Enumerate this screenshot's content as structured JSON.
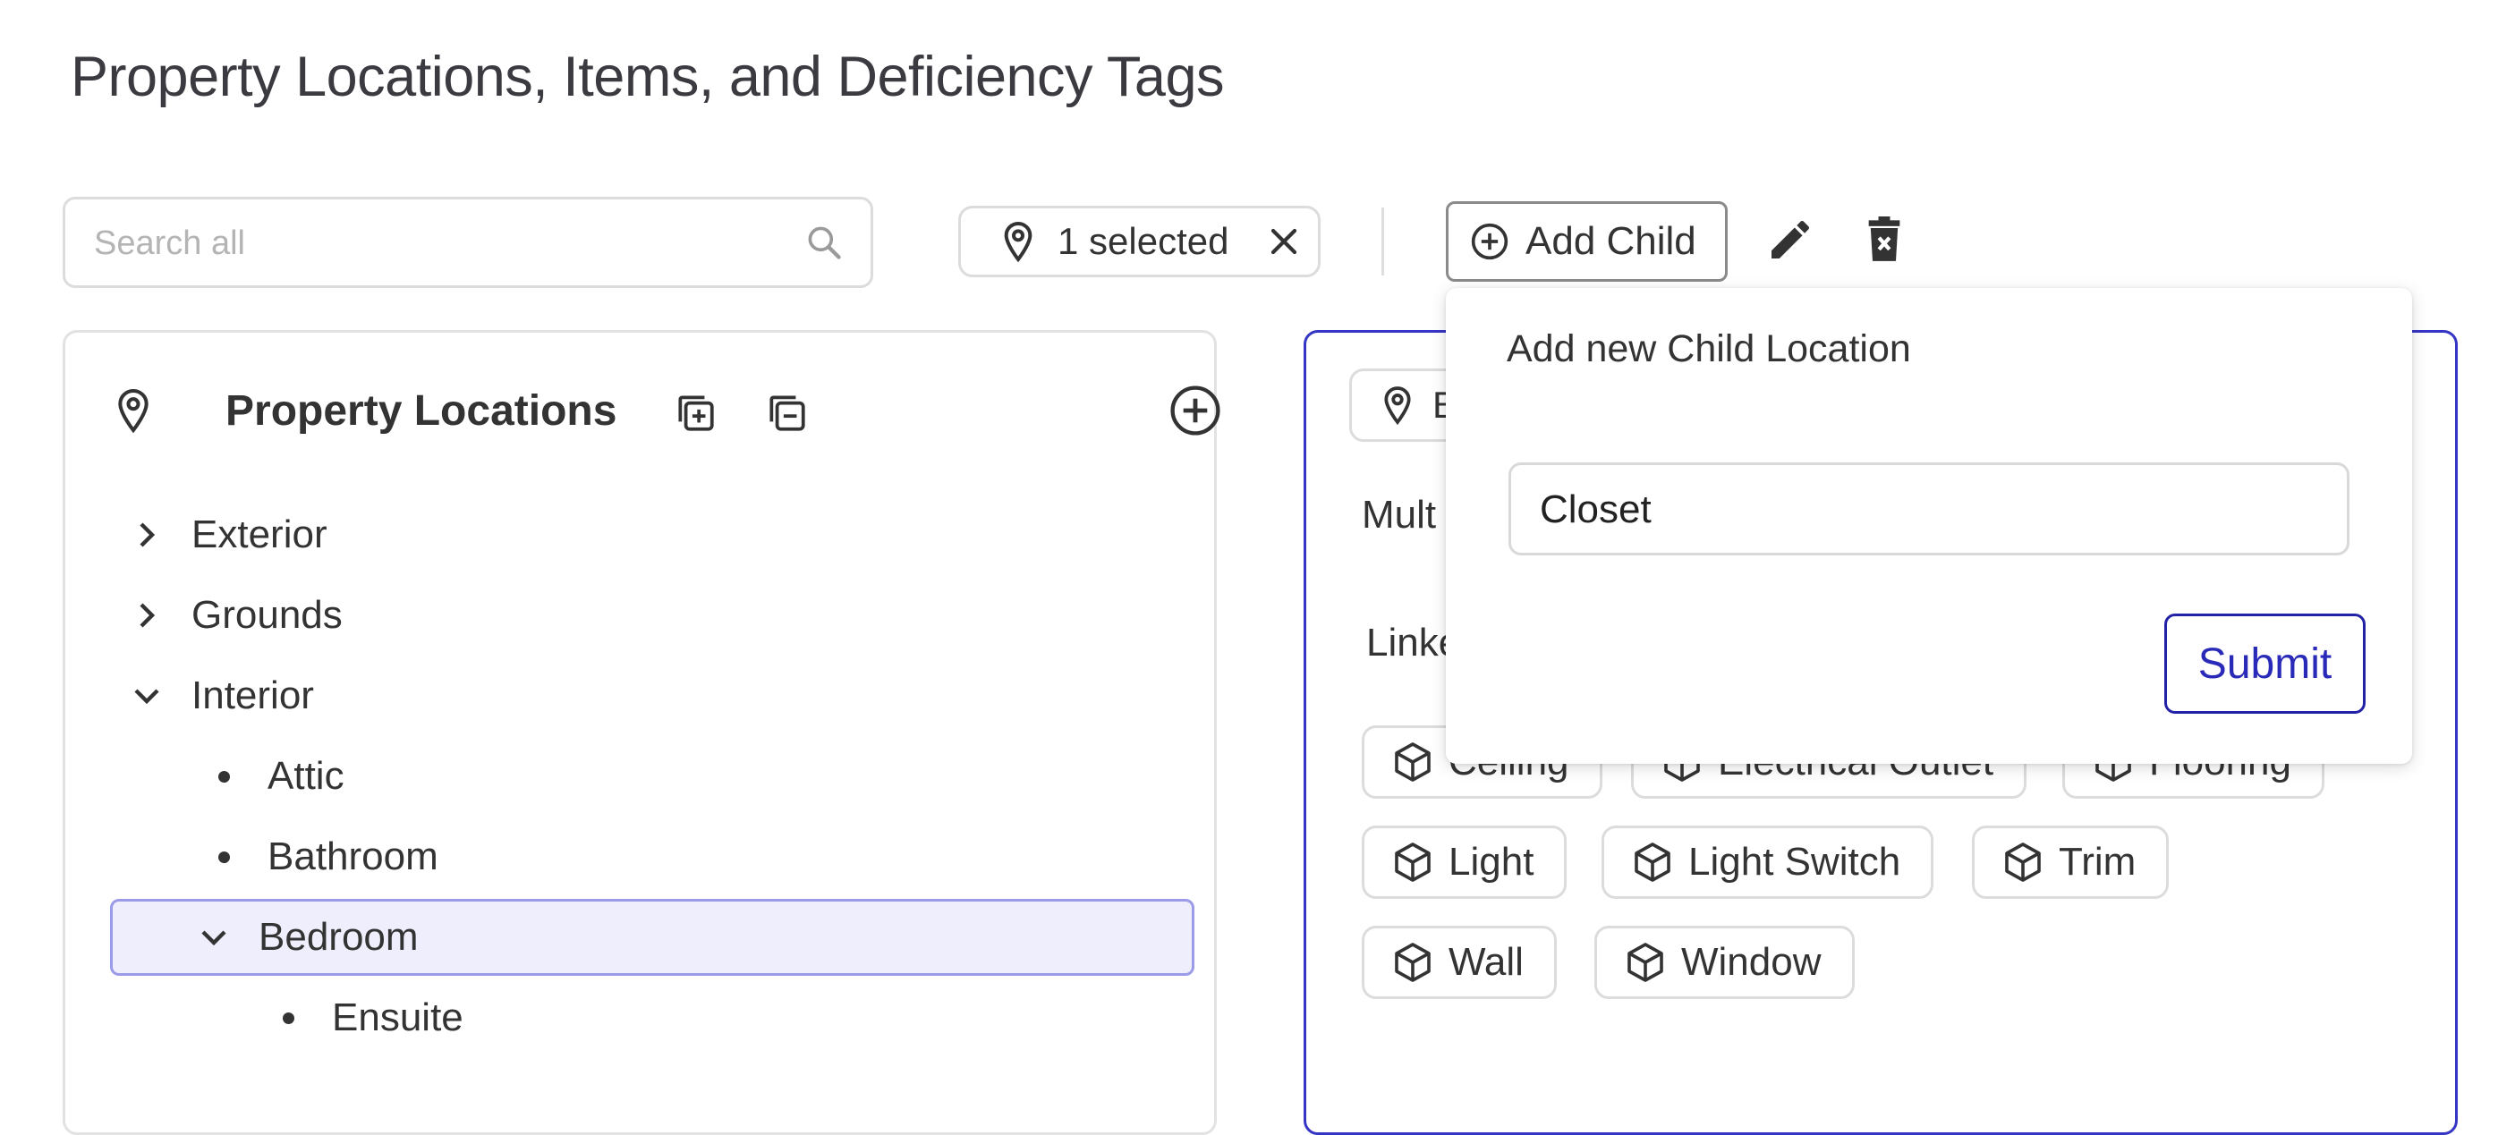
{
  "page": {
    "title": "Property Locations, Items, and Deficiency Tags"
  },
  "toolbar": {
    "search_placeholder": "Search all",
    "selected_label": "1 selected",
    "add_child_label": "Add Child"
  },
  "locations_panel": {
    "title": "Property Locations",
    "tree": {
      "exterior": "Exterior",
      "grounds": "Grounds",
      "interior": "Interior",
      "attic": "Attic",
      "bathroom": "Bathroom",
      "bedroom": "Bedroom",
      "ensuite": "Ensuite"
    }
  },
  "detail_panel": {
    "chip_label": "B",
    "multi_label": "Mult",
    "linked_label": "Linke",
    "items": {
      "ceiling": "Ceiling",
      "electrical_outlet": "Electrical Outlet",
      "flooring": "Flooring",
      "light": "Light",
      "light_switch": "Light Switch",
      "trim": "Trim",
      "wall": "Wall",
      "window": "Window"
    }
  },
  "popover": {
    "heading": "Add new Child Location",
    "input_value": "Closet",
    "submit_label": "Submit"
  },
  "colors": {
    "accent": "#2a2ab8",
    "selected_bg": "#eeeefd",
    "selected_border": "#9b9be8",
    "panel_border_active": "#3636c4"
  }
}
